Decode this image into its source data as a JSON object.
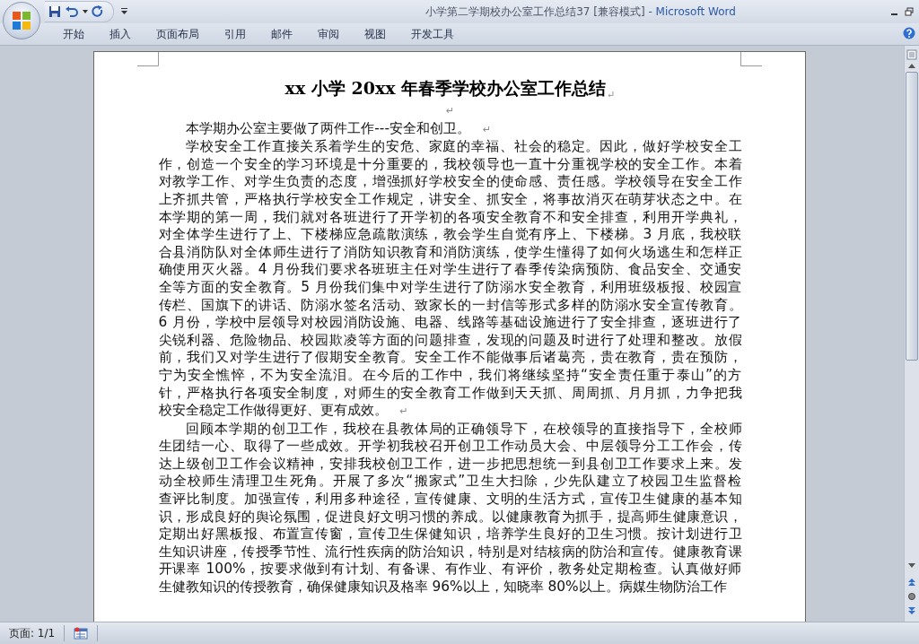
{
  "window": {
    "doc_title": "小学第二学期校办公室工作总结37 [兼容模式]",
    "app_name": "- Microsoft Word"
  },
  "ribbon_tabs": [
    {
      "label": "开始",
      "selected": false
    },
    {
      "label": "插入",
      "selected": false
    },
    {
      "label": "页面布局",
      "selected": false
    },
    {
      "label": "引用",
      "selected": false
    },
    {
      "label": "邮件",
      "selected": false
    },
    {
      "label": "审阅",
      "selected": false
    },
    {
      "label": "视图",
      "selected": false
    },
    {
      "label": "开发工具",
      "selected": false
    }
  ],
  "document": {
    "title": "xx 小学 20xx 年春季学校办公室工作总结",
    "title_mark": "↵",
    "paragraphs": [
      {
        "kind": "empty",
        "end_mark": "↵"
      },
      {
        "kind": "body",
        "end_mark": "↵",
        "lines": [
          "本学期办公室主要做了两件工作---安全和创卫。"
        ]
      },
      {
        "kind": "body",
        "end_mark": "↵",
        "lines": [
          "学校安全工作直接关系着学生的安危、家庭的幸福、社会的稳定。因此，做好学校安全工",
          "作，创造一个安全的学习环境是十分重要的，我校领导也一直十分重视学校的安全工作。本着",
          "对教学工作、对学生负责的态度，增强抓好学校安全的使命感、责任感。学校领导在安全工作",
          "上齐抓共管，严格执行学校安全工作规定，讲安全、抓安全，将事故消灭在萌芽状态之中。在",
          "本学期的第一周，我们就对各班进行了开学初的各项安全教育不和安全排查，利用开学典礼，",
          "对全体学生进行了上、下楼梯应急疏散演练，教会学生自觉有序上、下楼梯。3 月底，我校联",
          "合县消防队对全体师生进行了消防知识教育和消防演练，使学生懂得了如何火场逃生和怎样正",
          "确使用灭火器。4 月份我们要求各班班主任对学生进行了春季传染病预防、食品安全、交通安",
          "全等方面的安全教育。5 月份我们集中对学生进行了防溺水安全教育，利用班级板报、校园宣",
          "传栏、国旗下的讲话、防溺水签名活动、致家长的一封信等形式多样的防溺水安全宣传教育。",
          "6 月份，学校中层领导对校园消防设施、电器、线路等基础设施进行了安全排查，逐班进行了",
          "尖锐利器、危险物品、校园欺凌等方面的问题排查，发现的问题及时进行了处理和整改。放假",
          "前，我们又对学生进行了假期安全教育。安全工作不能做事后诸葛亮，贵在教育，贵在预防，",
          "宁为安全憔悴，不为安全流泪。在今后的工作中，我们将继续坚持“安全责任重于泰山”的方",
          "针，严格执行各项安全制度，对师生的安全教育工作做到天天抓、周周抓、月月抓，力争把我",
          "校安全稳定工作做得更好、更有成效。"
        ]
      },
      {
        "kind": "body",
        "lines": [
          "回顾本学期的创卫工作，我校在县教体局的正确领导下，在校领导的直接指导下，全校师",
          "生团结一心、取得了一些成效。开学初我校召开创卫工作动员大会、中层领导分工工作会，传",
          "达上级创卫工作会议精神，安排我校创卫工作，进一步把思想统一到县创卫工作要求上来。发",
          "动全校师生清理卫生死角。开展了多次“搬家式”卫生大扫除，少先队建立了校园卫生监督检",
          "查评比制度。加强宣传，利用多种途径，宣传健康、文明的生活方式，宣传卫生健康的基本知",
          "识，形成良好的舆论氛围，促进良好文明习惯的养成。以健康教育为抓手，提高师生健康意识，",
          "定期出好黑板报、布置宣传窗，宣传卫生保健知识，培养学生良好的卫生习惯。按计划进行卫",
          "生知识讲座，传授季节性、流行性疾病的防治知识，特别是对结核病的防治和宣传。健康教育课",
          "开课率 100%，按要求做到有计划、有备课、有作业、有评价，教务处定期检查。认真做好师",
          "生健教知识的传授教育，确保健康知识及格率 96%以上，知晓率 80%以上。病媒生物防治工作"
        ]
      }
    ]
  },
  "status_bar": {
    "page": "页面: 1/1"
  }
}
